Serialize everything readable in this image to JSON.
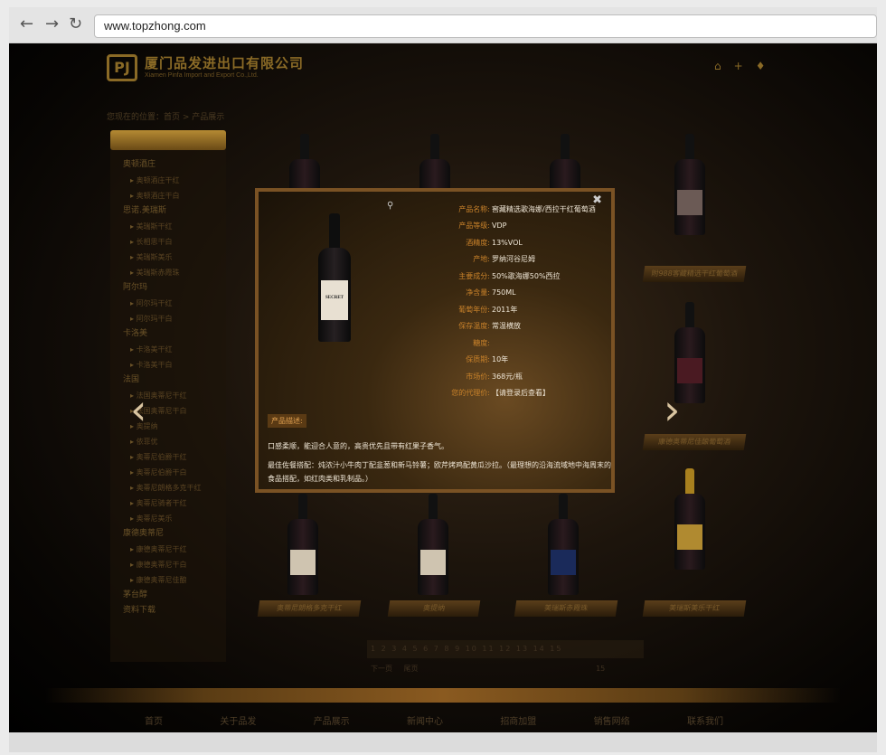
{
  "browser": {
    "back_icon": "arrow-left-icon",
    "forward_icon": "arrow-right-icon",
    "reload_icon": "reload-icon",
    "url": "www.topzhong.com"
  },
  "header": {
    "logo_cn": "厦门品发进出口有限公司",
    "logo_en": "Xiamen Pinfa Import and Export Co.,Ltd.",
    "logo_mark": "PJ"
  },
  "breadcrumb": "您现在的位置：首页 > 产品展示",
  "sidebar": {
    "items": [
      {
        "type": "cat",
        "label": "奥顿酒庄"
      },
      {
        "type": "sub",
        "label": "奥顿酒庄干红"
      },
      {
        "type": "sub",
        "label": "奥顿酒庄干白"
      },
      {
        "type": "cat",
        "label": "思诺.美瑞斯"
      },
      {
        "type": "sub",
        "label": "美瑞斯干红"
      },
      {
        "type": "sub",
        "label": "长相思干白"
      },
      {
        "type": "sub",
        "label": "美瑞斯美乐"
      },
      {
        "type": "sub",
        "label": "美瑞斯赤霞珠"
      },
      {
        "type": "cat",
        "label": "阿尔玛"
      },
      {
        "type": "sub",
        "label": "阿尔玛干红"
      },
      {
        "type": "sub",
        "label": "阿尔玛干白"
      },
      {
        "type": "cat",
        "label": "卡洛美"
      },
      {
        "type": "sub",
        "label": "卡洛美干红"
      },
      {
        "type": "sub",
        "label": "卡洛美干白"
      },
      {
        "type": "cat",
        "label": "法国"
      },
      {
        "type": "sub",
        "label": "法国奥蒂尼干红"
      },
      {
        "type": "sub",
        "label": "法国奥蒂尼干白"
      },
      {
        "type": "sub",
        "label": "奥提纳"
      },
      {
        "type": "sub",
        "label": "依菲优"
      },
      {
        "type": "sub",
        "label": "奥蒂尼伯爵干红"
      },
      {
        "type": "sub",
        "label": "奥蒂尼伯爵干白"
      },
      {
        "type": "sub",
        "label": "奥蒂尼朗格多克干红"
      },
      {
        "type": "sub",
        "label": "奥蒂尼骑者干红"
      },
      {
        "type": "sub",
        "label": "奥蒂尼美乐"
      },
      {
        "type": "cat",
        "label": "康德奥蒂尼"
      },
      {
        "type": "sub",
        "label": "康德奥蒂尼干红"
      },
      {
        "type": "sub",
        "label": "康德奥蒂尼干白"
      },
      {
        "type": "sub",
        "label": "康德奥蒂尼佳酿"
      },
      {
        "type": "cat",
        "label": "茅台醇"
      },
      {
        "type": "cat",
        "label": "资料下载"
      }
    ]
  },
  "products": [
    {
      "name": "附988客藏精选干红葡萄酒"
    },
    {
      "name": "康德奥蒂尼佳酿葡萄酒"
    },
    {
      "name": "奥蒂尼朗格多克干红"
    },
    {
      "name": "奥提纳"
    },
    {
      "name": "美瑞斯赤霞珠"
    },
    {
      "name": "美瑞斯美乐干红"
    }
  ],
  "pager": {
    "pages": "1 2 3 4 5 6 7 8 9 10 11 12 13 14 15",
    "next": "下一页",
    "last": "尾页",
    "total": "15"
  },
  "footer": [
    "首页",
    "关于品发",
    "产品展示",
    "新闻中心",
    "招商加盟",
    "销售网络",
    "联系我们"
  ],
  "modal": {
    "close_icon": "close-icon",
    "zoom_icon": "magnifier-icon",
    "bottle_label": "SECRET",
    "attributes": [
      {
        "key": "产品名称:",
        "value": "窖藏精选歌海娜/西拉干红葡萄酒"
      },
      {
        "key": "产品等级:",
        "value": "VDP"
      },
      {
        "key": "酒精度:",
        "value": "13%VOL"
      },
      {
        "key": "产地:",
        "value": "罗纳河谷尼姆"
      },
      {
        "key": "主要成分:",
        "value": "50%歌海娜50%西拉"
      },
      {
        "key": "净含量:",
        "value": "750ML"
      },
      {
        "key": "葡萄年份:",
        "value": "2011年"
      },
      {
        "key": "保存温度:",
        "value": "常温横放"
      },
      {
        "key": "糖度:",
        "value": ""
      },
      {
        "key": "保质期:",
        "value": "10年"
      },
      {
        "key": "市场价:",
        "value": "368元/瓶"
      },
      {
        "key": "您的代理价:",
        "value": "【请登录后查看】"
      }
    ],
    "desc_label": "产品描述:",
    "desc_line1": "口感柔顺，能迎合人意的，高贵优先且带有红果子香气。",
    "desc_line2": "最佳佐餐搭配：炖浓汁小牛肉丁配韭葱和新马铃薯；欧芹烤鸡配黄瓜沙拉。（最理想的沿海流域地中海周末的食品搭配，如红肉类和乳制品。）"
  },
  "arrows": {
    "prev": "‹",
    "next": "›"
  }
}
